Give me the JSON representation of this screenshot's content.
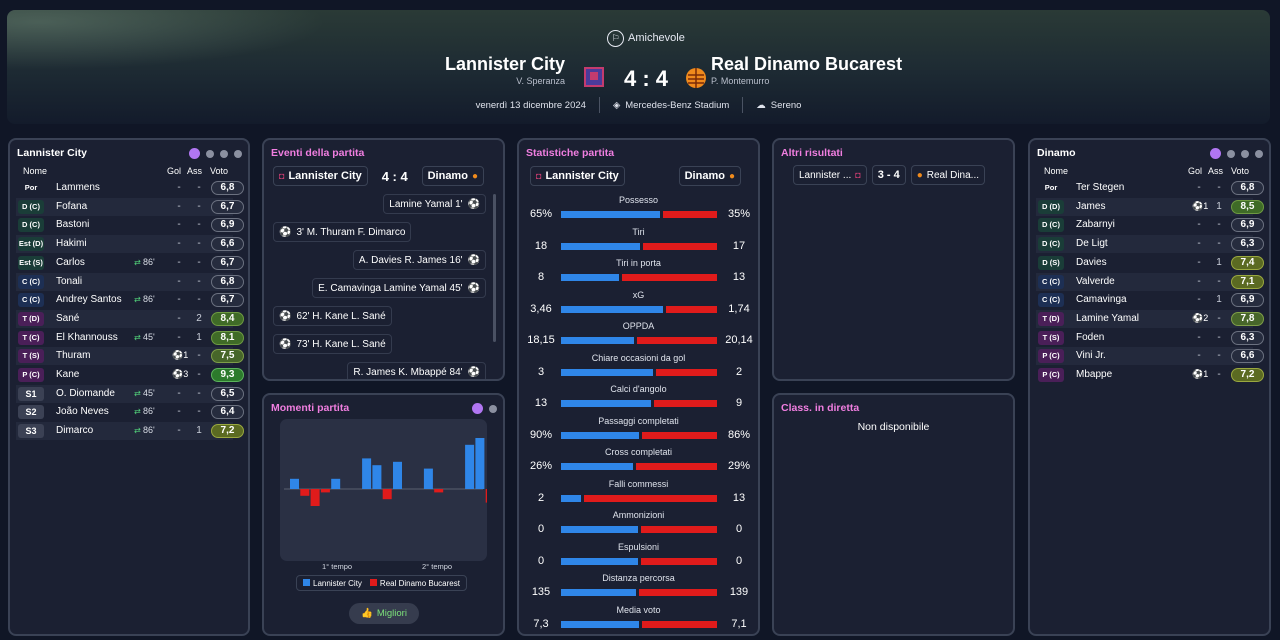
{
  "match": {
    "competition": "Amichevole",
    "home_team": "Lannister City",
    "home_coach": "V. Speranza",
    "away_team": "Real Dinamo Bucarest",
    "away_coach": "P. Montemurro",
    "score": "4 : 4",
    "date": "venerdì 13 dicembre 2024",
    "stadium": "Mercedes-Benz Stadium",
    "weather": "Sereno"
  },
  "home_lineup": {
    "title": "Lannister City",
    "headers": {
      "name": "Nome",
      "gol": "Gol",
      "ass": "Ass",
      "voto": "Voto"
    },
    "players": [
      {
        "pos": "Por",
        "name": "Lammens",
        "gol": "-",
        "ass": "-",
        "voto": "6,8"
      },
      {
        "pos": "D (C)",
        "name": "Fofana",
        "gol": "-",
        "ass": "-",
        "voto": "6,7"
      },
      {
        "pos": "D (C)",
        "name": "Bastoni",
        "gol": "-",
        "ass": "-",
        "voto": "6,9"
      },
      {
        "pos": "Est (D)",
        "name": "Hakimi",
        "gol": "-",
        "ass": "-",
        "voto": "6,6"
      },
      {
        "pos": "Est (S)",
        "name": "Carlos",
        "sub": "86'",
        "gol": "-",
        "ass": "-",
        "voto": "6,7"
      },
      {
        "pos": "C (C)",
        "name": "Tonali",
        "gol": "-",
        "ass": "-",
        "voto": "6,8"
      },
      {
        "pos": "C (C)",
        "name": "Andrey Santos",
        "sub": "86'",
        "gol": "-",
        "ass": "-",
        "voto": "6,7"
      },
      {
        "pos": "T (D)",
        "name": "Sané",
        "gol": "-",
        "ass": "2",
        "voto": "8,4"
      },
      {
        "pos": "T (C)",
        "name": "El Khannouss",
        "sub": "45'",
        "gol": "-",
        "ass": "1",
        "voto": "8,1"
      },
      {
        "pos": "T (S)",
        "name": "Thuram",
        "goals_icon": "⚽1",
        "ass": "-",
        "voto": "7,5"
      },
      {
        "pos": "P (C)",
        "name": "Kane",
        "goals_icon": "⚽3",
        "ass": "-",
        "voto": "9,3"
      },
      {
        "pos": "S1",
        "name": "O. Diomande",
        "sub": "45'",
        "gol": "-",
        "ass": "-",
        "voto": "6,5"
      },
      {
        "pos": "S2",
        "name": "João Neves",
        "sub": "86'",
        "gol": "-",
        "ass": "-",
        "voto": "6,4"
      },
      {
        "pos": "S3",
        "name": "Dimarco",
        "sub": "86'",
        "gol": "-",
        "ass": "1",
        "voto": "7,2"
      }
    ]
  },
  "away_lineup": {
    "title": "Dinamo",
    "headers": {
      "name": "Nome",
      "gol": "Gol",
      "ass": "Ass",
      "voto": "Voto"
    },
    "players": [
      {
        "pos": "Por",
        "name": "Ter Stegen",
        "gol": "-",
        "ass": "-",
        "voto": "6,8"
      },
      {
        "pos": "D (D)",
        "name": "James",
        "goals_icon": "⚽1",
        "ass": "1",
        "voto": "8,5"
      },
      {
        "pos": "D (C)",
        "name": "Zabarnyi",
        "gol": "-",
        "ass": "-",
        "voto": "6,9"
      },
      {
        "pos": "D (C)",
        "name": "De Ligt",
        "gol": "-",
        "ass": "-",
        "voto": "6,3"
      },
      {
        "pos": "D (S)",
        "name": "Davies",
        "gol": "-",
        "ass": "1",
        "voto": "7,4"
      },
      {
        "pos": "C (C)",
        "name": "Valverde",
        "gol": "-",
        "ass": "-",
        "voto": "7,1"
      },
      {
        "pos": "C (C)",
        "name": "Camavinga",
        "gol": "-",
        "ass": "1",
        "voto": "6,9"
      },
      {
        "pos": "T (D)",
        "name": "Lamine Yamal",
        "goals_icon": "⚽2",
        "ass": "-",
        "voto": "7,8"
      },
      {
        "pos": "T (S)",
        "name": "Foden",
        "gol": "-",
        "ass": "-",
        "voto": "6,3"
      },
      {
        "pos": "P (C)",
        "name": "Vini Jr.",
        "gol": "-",
        "ass": "-",
        "voto": "6,6"
      },
      {
        "pos": "P (C)",
        "name": "Mbappe",
        "goals_icon": "⚽1",
        "ass": "-",
        "voto": "7,2"
      }
    ]
  },
  "events": {
    "title": "Eventi della partita",
    "home_short": "Lannister City",
    "away_short": "Dinamo",
    "score": "4 : 4",
    "items": [
      {
        "side": "away",
        "text": "Lamine Yamal 1'"
      },
      {
        "side": "home",
        "text": "3' M. Thuram F. Dimarco"
      },
      {
        "side": "away",
        "text": "A. Davies  R. James 16'"
      },
      {
        "side": "away",
        "text": "E. Camavinga  Lamine Yamal 45'"
      },
      {
        "side": "home",
        "text": "62' H. Kane L. Sané"
      },
      {
        "side": "home",
        "text": "73' H. Kane L. Sané"
      },
      {
        "side": "away",
        "text": "R. James  K. Mbappé 84'"
      }
    ]
  },
  "momenti": {
    "title": "Momenti partita",
    "x_labels": [
      "1° tempo",
      "2° tempo"
    ],
    "legend": [
      "Lannister City",
      "Real Dinamo Bucarest"
    ],
    "button": "Migliori"
  },
  "chart_data": {
    "type": "bar",
    "series": [
      {
        "name": "Lannister City",
        "values": [
          3,
          0,
          0,
          0,
          3,
          0,
          0,
          9,
          7,
          0,
          8,
          0,
          0,
          6,
          0,
          0,
          0,
          13,
          15,
          0,
          0
        ]
      },
      {
        "name": "Real Dinamo Bucarest",
        "values": [
          0,
          -2,
          -5,
          -1,
          0,
          0,
          0,
          0,
          0,
          -3,
          0,
          0,
          0,
          0,
          -1,
          0,
          0,
          0,
          0,
          -4,
          -3
        ]
      }
    ],
    "colors": {
      "Lannister City": "#2f86e8",
      "Real Dinamo Bucarest": "#e01b1b"
    }
  },
  "stats": {
    "title": "Statistiche partita",
    "home_short": "Lannister City",
    "away_short": "Dinamo",
    "items": [
      {
        "label": "Possesso",
        "home": "65%",
        "away": "35%",
        "h": 65,
        "a": 35
      },
      {
        "label": "Tiri",
        "home": "18",
        "away": "17",
        "h": 18,
        "a": 17
      },
      {
        "label": "Tiri in porta",
        "home": "8",
        "away": "13",
        "h": 8,
        "a": 13
      },
      {
        "label": "xG",
        "home": "3,46",
        "away": "1,74",
        "h": 3.46,
        "a": 1.74
      },
      {
        "label": "OPPDA",
        "home": "18,15",
        "away": "20,14",
        "h": 18.15,
        "a": 20.14
      },
      {
        "label": "Chiare occasioni da gol",
        "home": "3",
        "away": "2",
        "h": 3,
        "a": 2
      },
      {
        "label": "Calci d'angolo",
        "home": "13",
        "away": "9",
        "h": 13,
        "a": 9
      },
      {
        "label": "Passaggi completati",
        "home": "90%",
        "away": "86%",
        "h": 90,
        "a": 86
      },
      {
        "label": "Cross completati",
        "home": "26%",
        "away": "29%",
        "h": 26,
        "a": 29
      },
      {
        "label": "Falli commessi",
        "home": "2",
        "away": "13",
        "h": 2,
        "a": 13
      },
      {
        "label": "Ammonizioni",
        "home": "0",
        "away": "0",
        "h": 0,
        "a": 0
      },
      {
        "label": "Espulsioni",
        "home": "0",
        "away": "0",
        "h": 0,
        "a": 0
      },
      {
        "label": "Distanza percorsa",
        "home": "135",
        "away": "139",
        "h": 135,
        "a": 139
      },
      {
        "label": "Media voto",
        "home": "7,3",
        "away": "7,1",
        "h": 7.3,
        "a": 7.1
      }
    ]
  },
  "other_results": {
    "title": "Altri risultati",
    "home": "Lannister ...",
    "score": "3 - 4",
    "away": "Real Dina..."
  },
  "live_table": {
    "title": "Class. in diretta",
    "text": "Non disponibile"
  },
  "colors": {
    "home": "#2f86e8",
    "away": "#e01b1b",
    "accent_pink": "#f07ee0",
    "accent_purple": "#b176f2"
  }
}
